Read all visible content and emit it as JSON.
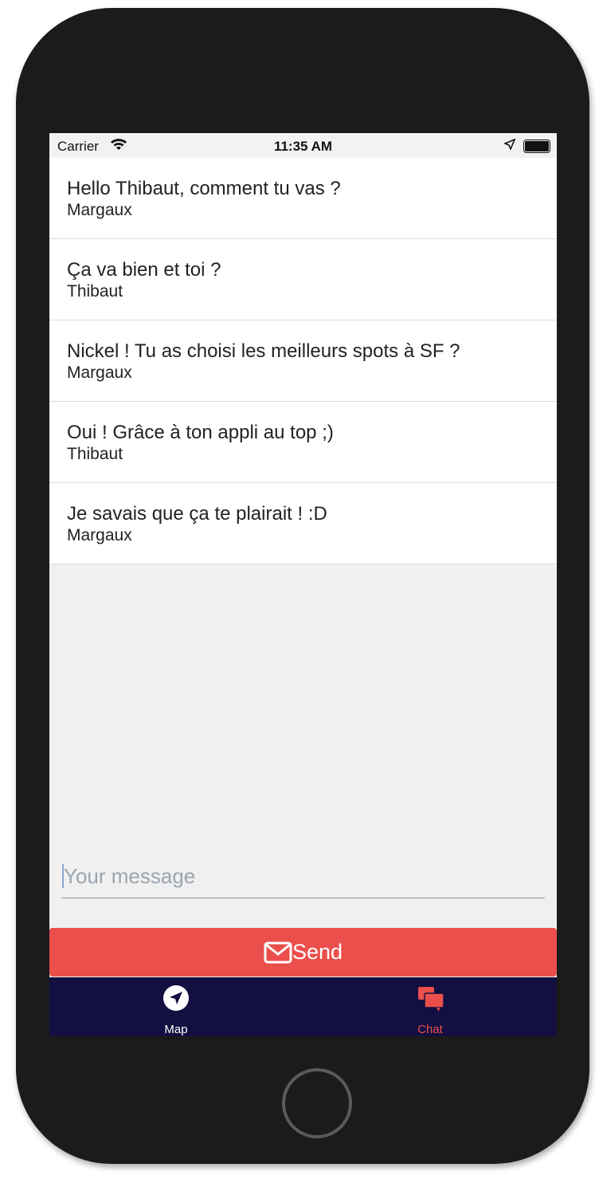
{
  "status_bar": {
    "carrier": "Carrier",
    "time": "11:35 AM"
  },
  "messages": [
    {
      "text": "Hello Thibaut, comment tu vas ?",
      "author": "Margaux"
    },
    {
      "text": "Ça va bien et toi ?",
      "author": "Thibaut"
    },
    {
      "text": "Nickel ! Tu as choisi les meilleurs spots à SF ?",
      "author": "Margaux"
    },
    {
      "text": "Oui ! Grâce à ton appli au top ;)",
      "author": "Thibaut"
    },
    {
      "text": "Je savais que ça te plairait ! :D",
      "author": "Margaux"
    }
  ],
  "composer": {
    "placeholder": "Your message",
    "send_label": "Send"
  },
  "tabs": [
    {
      "label": "Map",
      "icon": "navigation-icon"
    },
    {
      "label": "Chat",
      "icon": "chat-icon",
      "active": true
    }
  ],
  "colors": {
    "accent": "#eb4f4c",
    "tabbar": "#130f40"
  }
}
